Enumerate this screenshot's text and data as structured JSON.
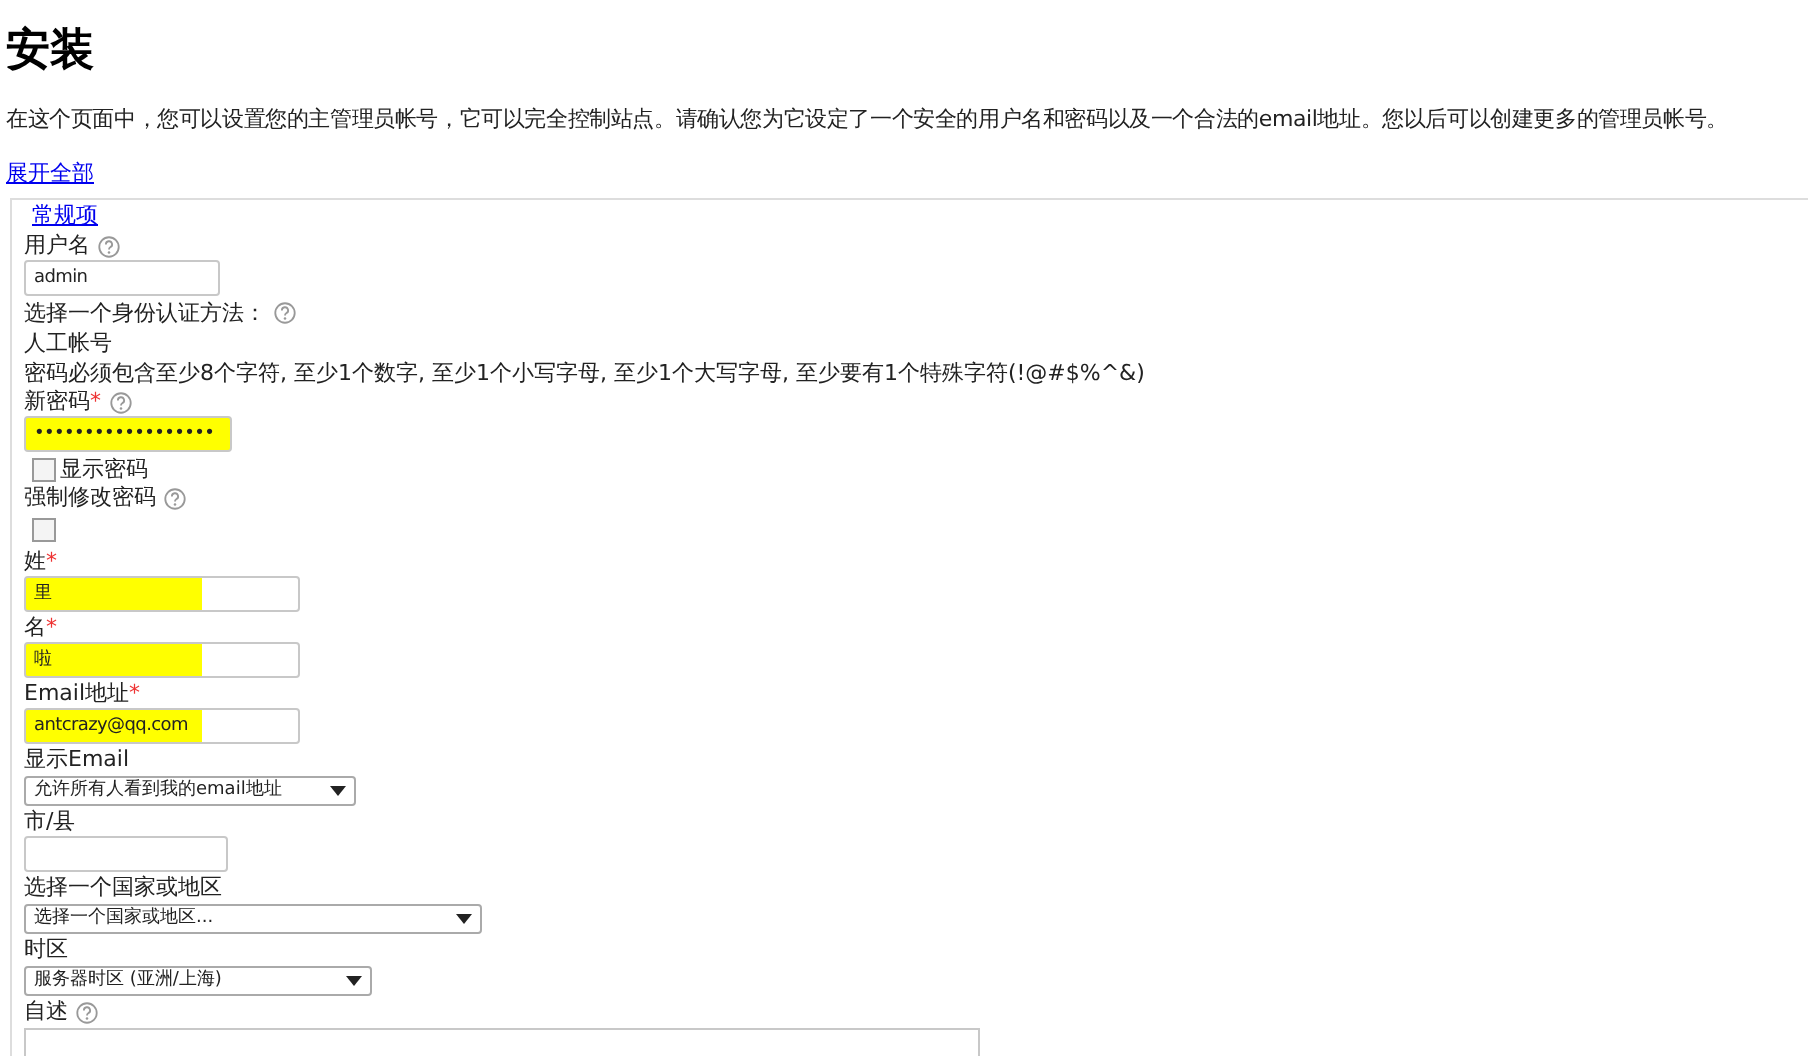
{
  "title": "安装",
  "intro": "在这个页面中，您可以设置您的主管理员帐号，它可以完全控制站点。请确认您为它设定了一个安全的用户名和密码以及一个合法的email地址。您以后可以创建更多的管理员帐号。",
  "expand_link": "展开全部",
  "section": {
    "legend": "常规项",
    "fields": [
      {
        "kind": "text",
        "label": "用户名",
        "help": true,
        "value": "admin",
        "highlighted": false
      },
      {
        "kind": "heading",
        "label": "选择一个身份认证方法：",
        "help": true
      },
      {
        "kind": "note",
        "label": "人工帐号"
      },
      {
        "kind": "note",
        "label": "密码必须包含至少8个字符, 至少1个数字, 至少1个小写字母, 至少1个大写字母, 至少要有1个特殊字符(!@#$%^&)"
      },
      {
        "kind": "text",
        "label": "新密码",
        "required_mark": "*",
        "help": true,
        "value": "••••••••••••••••••",
        "highlighted": true
      },
      {
        "kind": "checkbox",
        "label": "显示密码",
        "checked": false
      },
      {
        "kind": "checkbox-field",
        "label": "强制修改密码",
        "help": true,
        "checked": false
      },
      {
        "kind": "text",
        "label": "姓",
        "required_mark": "*",
        "value": "里",
        "highlighted": true
      },
      {
        "kind": "text",
        "label": "名",
        "required_mark": "*",
        "value": "啦",
        "highlighted": true
      },
      {
        "kind": "text",
        "label": "Email地址",
        "required_mark": "*",
        "value": "antcrazy@qq.com",
        "highlighted": true
      },
      {
        "kind": "select",
        "label": "显示Email",
        "value": "允许所有人看到我的email地址"
      },
      {
        "kind": "text",
        "label": "市/县",
        "highlighted": false
      },
      {
        "kind": "select",
        "label": "选择一个国家或地区",
        "value": "选择一个国家或地区..."
      },
      {
        "kind": "select",
        "label": "时区",
        "value": "服务器时区 (亚洲/上海)"
      },
      {
        "kind": "textarea",
        "label": "自述",
        "help": true
      }
    ]
  }
}
